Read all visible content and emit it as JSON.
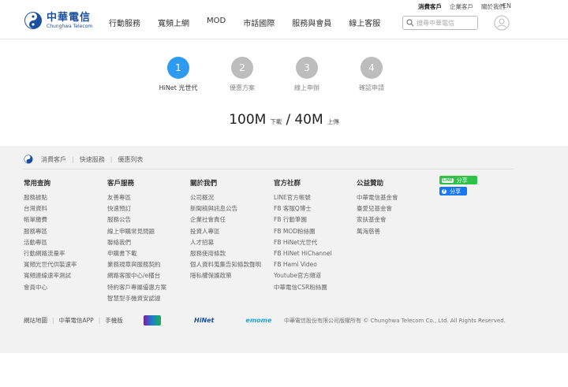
{
  "header": {
    "logo_zh": "中華電信",
    "logo_en": "Chunghwa Telecom",
    "top_links": [
      "消費客戶",
      "企業客戶",
      "關於我們"
    ],
    "lang": "EN",
    "nav": [
      "行動服務",
      "寬頻上網",
      "MOD",
      "市話國際",
      "服務與會員",
      "線上客服"
    ],
    "search_placeholder": "搜尋中華電信"
  },
  "steps": [
    {
      "num": "1",
      "label": "HiNet 光世代",
      "active": true
    },
    {
      "num": "2",
      "label": "優惠方案",
      "active": false
    },
    {
      "num": "3",
      "label": "線上申辦",
      "active": false
    },
    {
      "num": "4",
      "label": "確認申請",
      "active": false
    }
  ],
  "speed": {
    "down": "100M",
    "down_label": "下載",
    "slash": "/",
    "up": "40M",
    "up_label": "上傳"
  },
  "breadcrumb": [
    "消費客戶",
    "快速服務",
    "優惠列表"
  ],
  "footer_cols": [
    {
      "title": "常用查詢",
      "items": [
        "服務據點",
        "台灣資料",
        "帳單繳費",
        "服務專區",
        "活動專區",
        "行動網路流量率",
        "寬頻光世代供裝速率",
        "寬頻連線速率測試",
        "會員中心"
      ]
    },
    {
      "title": "客戶服務",
      "items": [
        "友善專區",
        "快速預訂",
        "服務公告",
        "線上申購常見問題",
        "聯絡我們",
        "申購書下載",
        "業務規章與服務契約",
        "網路客服中心/e櫃台",
        "特約客戶專屬優惠方案",
        "智慧型手機資安認證"
      ]
    },
    {
      "title": "關於我們",
      "items": [
        "公司概況",
        "新聞稿與訊息公告",
        "企業社會責任",
        "投資人專區",
        "人才招募",
        "服務使用條款",
        "個人資料蒐集告知條款聲明",
        "隱私權保護政策"
      ]
    },
    {
      "title": "官方社群",
      "items": [
        "LINE官方帳號",
        "FB 客服Q博士",
        "FB 行動筆園",
        "FB MOD粉絲團",
        "FB HiNet光世代",
        "FB HiNet HiChannel",
        "FB Hami Video",
        "Youtube官方頻道",
        "中華電信CSR粉絲團"
      ]
    },
    {
      "title": "公益贊助",
      "items": [
        "中華電信基金會",
        "臺愛兒基金會",
        "家扶基金會",
        "萬海慈善"
      ]
    }
  ],
  "share": {
    "line_label": "分享",
    "line_icon": "LINE",
    "fb_label": "分享",
    "fb_icon": "f"
  },
  "bottom_links": [
    "網站地圖",
    "中華電信APP",
    "手機版"
  ],
  "brands": {
    "hinet": "HiNet",
    "emome": "emome"
  },
  "copyright": "中華電信股份有限公司版權所有 © Chunghwa Telecom Co., Ltd. All Rights Reserved."
}
